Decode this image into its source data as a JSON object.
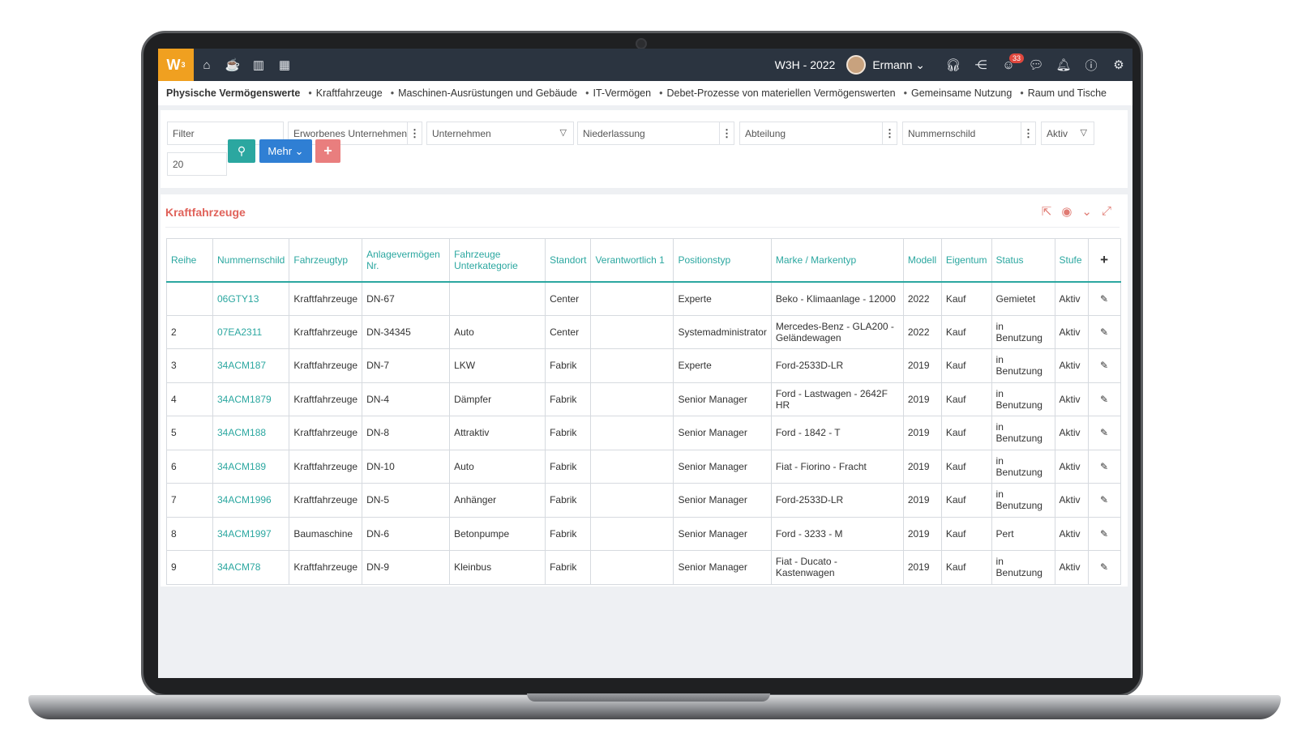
{
  "topbar": {
    "logo": "W",
    "logo_sup": "3",
    "nav_icons": [
      "home-icon",
      "coffee-icon",
      "bar-chart-icon",
      "calendar-icon"
    ],
    "company": "W3H - 2022",
    "username": "Ermann",
    "notification_count": "33",
    "right_icons": [
      "headset-icon",
      "share-icon",
      "smiley-icon",
      "chat-icon",
      "bell-icon",
      "help-icon",
      "gear-icon"
    ]
  },
  "breadcrumb": {
    "first": "Physische Vermögenswerte",
    "items": [
      "Kraftfahrzeuge",
      "Maschinen-Ausrüstungen und Gebäude",
      "IT-Vermögen",
      "Debet-Prozesse von materiellen Vermögenswerten",
      "Gemeinsame Nutzung",
      "Raum und Tische"
    ]
  },
  "filters": {
    "filter": "Filter",
    "acquired_company": "Erworbenes Unternehmen",
    "company": "Unternehmen",
    "branch": "Niederlassung",
    "department": "Abteilung",
    "plate": "Nummernschild",
    "status": "Aktiv",
    "page_size": "20",
    "more_label": "Mehr",
    "add_label": "+"
  },
  "panel": {
    "title": "Kraftfahrzeuge"
  },
  "table": {
    "headers": [
      "Reihe",
      "Nummernschild",
      "Fahrzeugtyp",
      "Anlagevermögen Nr.",
      "Fahrzeuge Unterkategorie",
      "Standort",
      "Verantwortlich 1",
      "Positionstyp",
      "Marke / Markentyp",
      "Modell",
      "Eigentum",
      "Status",
      "Stufe"
    ],
    "rows": [
      [
        "",
        "06GTY13",
        "Kraftfahrzeuge",
        "DN-67",
        "",
        "Center",
        "",
        "Experte",
        "Beko - Klimaanlage - 12000",
        "2022",
        "Kauf",
        "Gemietet",
        "Aktiv"
      ],
      [
        "2",
        "07EA2311",
        "Kraftfahrzeuge",
        "DN-34345",
        "Auto",
        "Center",
        "",
        "Systemadministrator",
        "Mercedes-Benz - GLA200 - Geländewagen",
        "2022",
        "Kauf",
        "in Benutzung",
        "Aktiv"
      ],
      [
        "3",
        "34ACM187",
        "Kraftfahrzeuge",
        "DN-7",
        "LKW",
        "Fabrik",
        "",
        "Experte",
        "Ford-2533D-LR",
        "2019",
        "Kauf",
        "in Benutzung",
        "Aktiv"
      ],
      [
        "4",
        "34ACM1879",
        "Kraftfahrzeuge",
        "DN-4",
        "Dämpfer",
        "Fabrik",
        "",
        "Senior Manager",
        "Ford - Lastwagen - 2642F HR",
        "2019",
        "Kauf",
        "in Benutzung",
        "Aktiv"
      ],
      [
        "5",
        "34ACM188",
        "Kraftfahrzeuge",
        "DN-8",
        "Attraktiv",
        "Fabrik",
        "",
        "Senior Manager",
        "Ford - 1842 - T",
        "2019",
        "Kauf",
        "in Benutzung",
        "Aktiv"
      ],
      [
        "6",
        "34ACM189",
        "Kraftfahrzeuge",
        "DN-10",
        "Auto",
        "Fabrik",
        "",
        "Senior Manager",
        "Fiat - Fiorino - Fracht",
        "2019",
        "Kauf",
        "in Benutzung",
        "Aktiv"
      ],
      [
        "7",
        "34ACM1996",
        "Kraftfahrzeuge",
        "DN-5",
        "Anhänger",
        "Fabrik",
        "",
        "Senior Manager",
        "Ford-2533D-LR",
        "2019",
        "Kauf",
        "in Benutzung",
        "Aktiv"
      ],
      [
        "8",
        "34ACM1997",
        "Baumaschine",
        "DN-6",
        "Betonpumpe",
        "Fabrik",
        "",
        "Senior Manager",
        "Ford - 3233 - M",
        "2019",
        "Kauf",
        "Pert",
        "Aktiv"
      ],
      [
        "9",
        "34ACM78",
        "Kraftfahrzeuge",
        "DN-9",
        "Kleinbus",
        "Fabrik",
        "",
        "Senior Manager",
        "Fiat - Ducato - Kastenwagen",
        "2019",
        "Kauf",
        "in Benutzung",
        "Aktiv"
      ]
    ]
  }
}
